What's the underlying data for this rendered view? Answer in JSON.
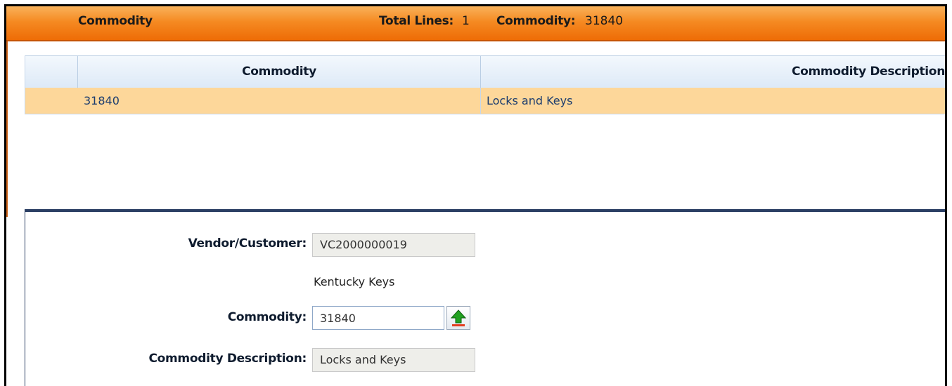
{
  "header": {
    "title": "Commodity",
    "total_lines_label": "Total Lines:",
    "total_lines_value": "1",
    "commodity_label": "Commodity:",
    "commodity_value": "31840"
  },
  "grid": {
    "columns": [
      "Commodity",
      "Commodity Description"
    ],
    "rows": [
      {
        "commodity": "31840",
        "description": "Locks and Keys",
        "selected": true
      }
    ],
    "selected_row_color": "#fdd79a"
  },
  "detail": {
    "vendor_label": "Vendor/Customer:",
    "vendor_value": "VC2000000019",
    "vendor_name": "Kentucky Keys",
    "commodity_label": "Commodity:",
    "commodity_value": "31840",
    "description_label": "Commodity Description:",
    "description_value": "Locks and Keys",
    "lookup_icon": "upload-arrow-icon"
  },
  "colors": {
    "header_orange": "#f58a22",
    "panel_border": "#2b3f64",
    "grid_header": "#dde9f7"
  }
}
